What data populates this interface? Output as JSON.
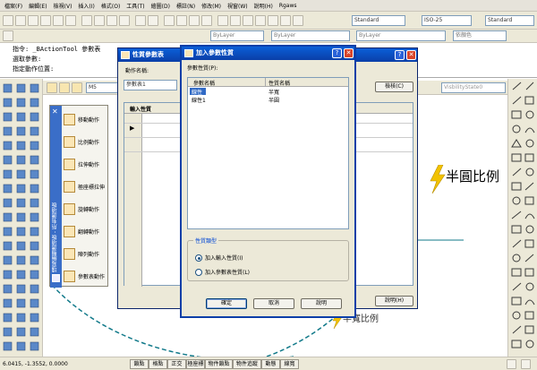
{
  "menubar": {
    "items": [
      "檔案(F)",
      "編輯(E)",
      "檢視(V)",
      "插入(I)",
      "格式(O)",
      "工具(T)",
      "繪圖(D)",
      "標註(N)",
      "修改(M)",
      "視窗(W)",
      "說明(H)",
      "Rgaws"
    ]
  },
  "toolbar": {
    "text_style": "Standard",
    "dim_style": "ISO-25",
    "table_style": "Standard",
    "layer_color": "ByLayer",
    "linetype": "ByLayer",
    "lineweight": "ByLayer",
    "plotstyle": "依顏色"
  },
  "command_line": {
    "line1": "指令: _BActionTool 參數表",
    "line2": "選取參數:",
    "line3": "指定動作位置:"
  },
  "block_editor": {
    "block_name": "M5",
    "visibility": "VisbilityState0"
  },
  "canvas": {
    "label_semicircle": "半圓比例",
    "label_halfwidth": "半寬比例"
  },
  "palette": {
    "title": "塊寫編輯選項板 - 所有選項板",
    "items": [
      "移動動作",
      "比例動作",
      "拉伸動作",
      "極座標拉伸",
      "旋轉動作",
      "翻轉動作",
      "陣列動作",
      "參數表動作"
    ]
  },
  "param_table_dialog": {
    "title": "性質參數表",
    "action_name_label": "動作名稱:",
    "action_name_value": "參數表1",
    "check_button": "檢核(C)",
    "input_props_header": "輸入性質",
    "help_button": "說明(H)"
  },
  "add_param_dialog": {
    "title": "加入參數性質",
    "param_props_label": "參數性質(P):",
    "col_param_name": "參數名稱",
    "col_prop_name": "性質名稱",
    "rows": [
      {
        "param": "線性",
        "prop": "半寬",
        "selected": true
      },
      {
        "param": "線性1",
        "prop": "半圓",
        "selected": false
      }
    ],
    "prop_type_label": "性質類型",
    "radio_input": "加入輸入性質(I)",
    "radio_lookup": "加入參數表性質(L)",
    "ok_button": "確定",
    "cancel_button": "取消",
    "help_button": "說明"
  },
  "status": {
    "coords": "6.0415, -1.3552, 0.0000",
    "buttons": [
      "鎖點",
      "格點",
      "正交",
      "極座標",
      "物件鎖點",
      "物件追蹤",
      "動態",
      "線寬"
    ]
  },
  "colors": {
    "title_blue": "#0a3fa8",
    "palette_blue": "#3a6ec8",
    "lightning_yellow": "#f2c200",
    "canvas_line_teal": "#127a8a"
  }
}
